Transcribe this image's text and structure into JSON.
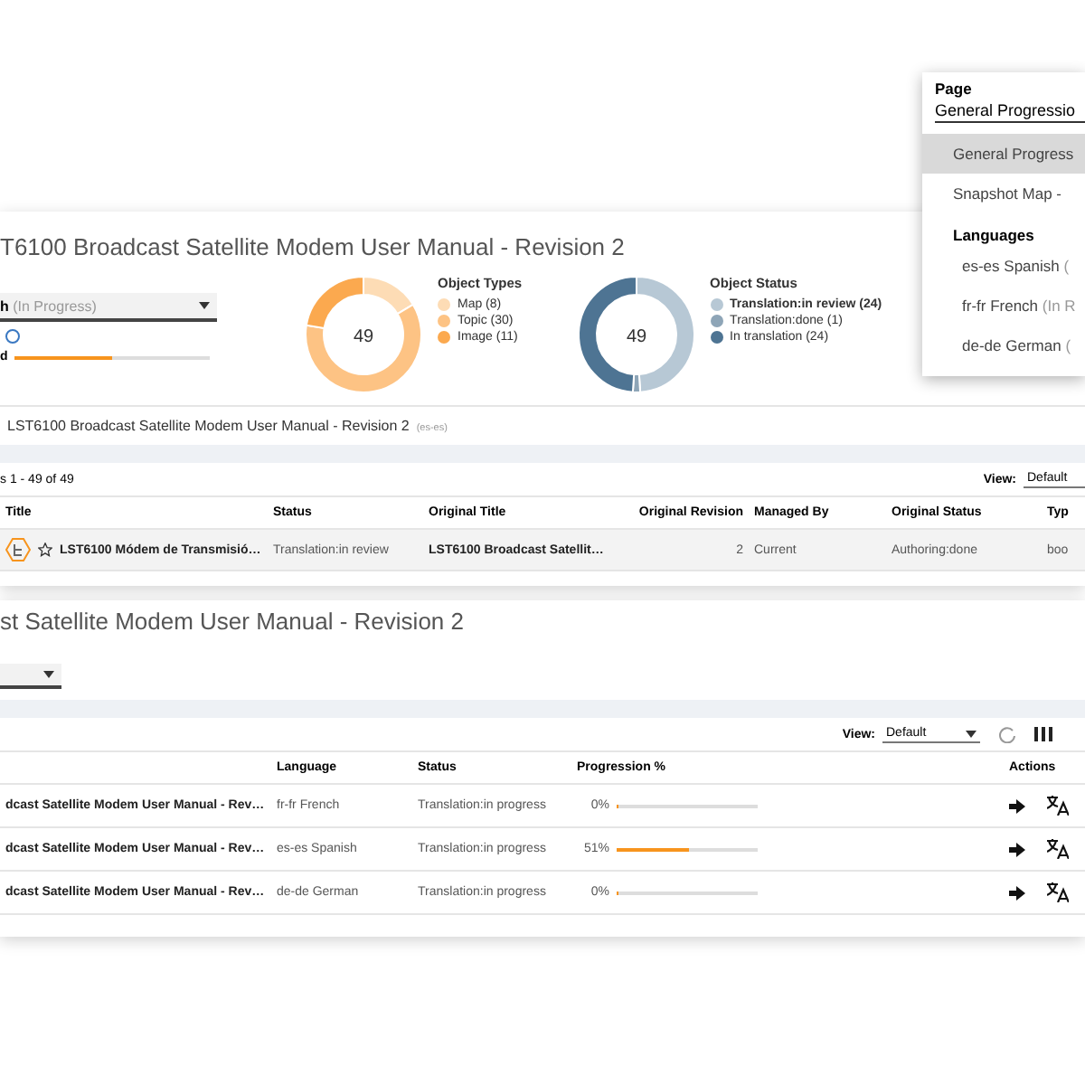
{
  "overview": {
    "title": "T6100 Broadcast Satellite Modem User Manual - Revision 2",
    "language_select": {
      "value": "h",
      "note": "(In Progress)"
    },
    "progress": {
      "label": "d",
      "level": 0.5
    },
    "charts": [
      {
        "title": "Object Types",
        "total": "49",
        "chart_data": {
          "type": "donut",
          "categories": [
            "Map (8)",
            "Topic (30)",
            "Image (11)"
          ],
          "values": [
            8,
            30,
            11
          ],
          "colors": [
            "#fddcb5",
            "#fdc384",
            "#fba94f"
          ]
        }
      },
      {
        "title": "Object Status",
        "total": "49",
        "chart_data": {
          "type": "donut",
          "categories": [
            "Translation:in review (24)",
            "Translation:done (1)",
            "In translation (24)"
          ],
          "values": [
            24,
            1,
            24
          ],
          "colors": [
            "#b7c8d5",
            "#8ea5b7",
            "#4e7493"
          ]
        }
      }
    ],
    "breadcrumb": {
      "title": "LST6100 Broadcast Satellite Modem User Manual - Revision 2",
      "code": "(es-es)"
    }
  },
  "objects_table": {
    "count": "s 1 - 49 of 49",
    "view_label": "View:",
    "view_value": "Default",
    "columns": [
      "Title",
      "Status",
      "Original Title",
      "Original Revision",
      "Managed By",
      "Original Status",
      "Typ"
    ],
    "rows": [
      {
        "starred": false,
        "cells": [
          "LST6100 Módem de Transmisió…",
          "Translation:in review",
          "LST6100 Broadcast Satellit…",
          "2",
          "Current",
          "Authoring:done",
          "boo"
        ]
      }
    ]
  },
  "progress_panel": {
    "title": "st Satellite Modem User Manual - Revision 2",
    "view_label": "View:",
    "view_value": "Default",
    "columns": [
      "",
      "Language",
      "Status",
      "Progression %",
      "",
      "Actions"
    ],
    "rows": [
      {
        "title": "dcast Satellite Modem User Manual - Rev…",
        "language": "fr-fr French",
        "status": "Translation:in progress",
        "percent": "0%",
        "level": 0
      },
      {
        "title": "dcast Satellite Modem User Manual - Rev…",
        "language": "es-es Spanish",
        "status": "Translation:in progress",
        "percent": "51%",
        "level": 0.51
      },
      {
        "title": "dcast Satellite Modem User Manual - Rev…",
        "language": "de-de German",
        "status": "Translation:in progress",
        "percent": "0%",
        "level": 0
      }
    ]
  },
  "page_menu": {
    "label": "Page",
    "value": "General Progressio",
    "items": [
      {
        "label": "General Progress",
        "selected": true
      },
      {
        "label": "Snapshot Map -",
        "selected": false
      }
    ],
    "section": "Languages",
    "languages": [
      {
        "name": "es-es Spanish",
        "note": "("
      },
      {
        "name": "fr-fr French",
        "note": "(In R"
      },
      {
        "name": "de-de German",
        "note": "("
      }
    ]
  }
}
